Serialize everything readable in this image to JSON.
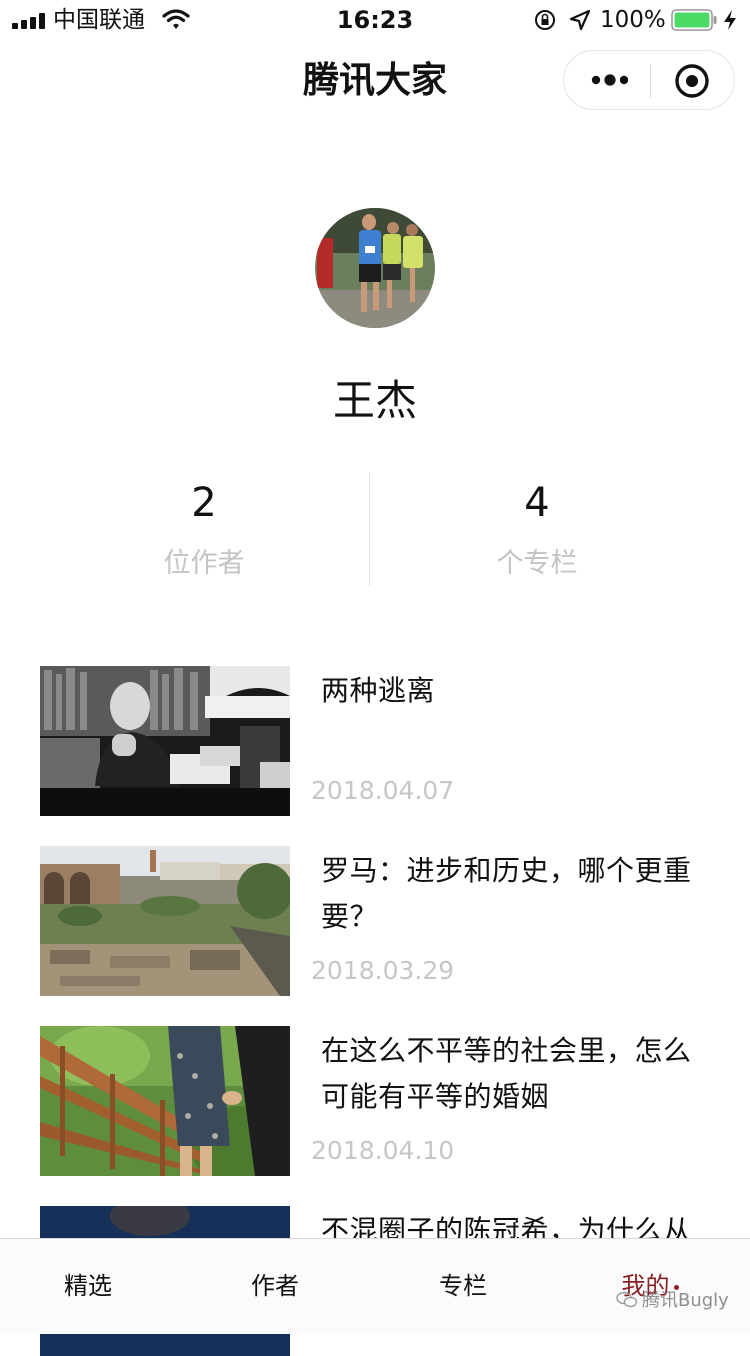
{
  "status_bar": {
    "carrier": "中国联通",
    "time": "16:23",
    "battery": "100%"
  },
  "nav": {
    "title": "腾讯大家"
  },
  "profile": {
    "name": "王杰",
    "stats": [
      {
        "value": "2",
        "label": "位作者"
      },
      {
        "value": "4",
        "label": "个专栏"
      }
    ]
  },
  "articles": [
    {
      "title": "两种逃离",
      "date": "2018.04.07"
    },
    {
      "title": "罗马：进步和历史，哪个更重要？",
      "date": "2018.03.29"
    },
    {
      "title": "在这么不平等的社会里，怎么可能有平等的婚姻",
      "date": "2018.04.10"
    },
    {
      "title": "不混圈子的陈冠希，为什么从",
      "date": ""
    }
  ],
  "tab_bar": {
    "tabs": [
      "精选",
      "作者",
      "专栏",
      "我的"
    ],
    "active": "我的"
  },
  "watermark": "腾讯Bugly"
}
